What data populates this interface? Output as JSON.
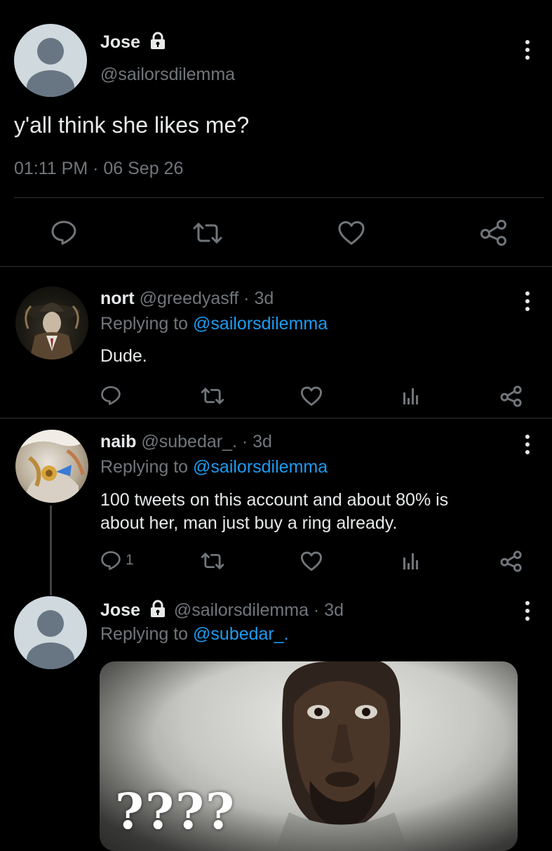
{
  "main_tweet": {
    "author_name": "Jose",
    "author_handle": "@sailorsdilemma",
    "text": "y'all think she likes me?",
    "timestamp": "01:11 PM · 06 Sep 26",
    "actions": [
      "reply-icon",
      "retweet-icon",
      "like-icon",
      "share-icon"
    ]
  },
  "replies": [
    {
      "author_name": "nort",
      "meta": "@greedyasff · 3d",
      "replying_label": "Replying to ",
      "replying_handle": "@sailorsdilemma",
      "text": "Dude.",
      "reply_count": ""
    },
    {
      "author_name": "naib",
      "meta": "@subedar_. · 3d",
      "replying_label": "Replying to ",
      "replying_handle": "@sailorsdilemma",
      "text_line1": "100 tweets on this account and about 80% is",
      "text_line2": "about her, man just buy a ring already.",
      "reply_count": "1"
    },
    {
      "author_name": "Jose",
      "meta": "@sailorsdilemma · 3d",
      "replying_label": "Replying to ",
      "replying_handle": "@subedar_.",
      "media_caption": "????"
    }
  ],
  "colors": {
    "background": "#000000",
    "text": "#e7e9ea",
    "muted": "#71767b",
    "link": "#1d9bf0",
    "divider": "#2f3336"
  }
}
